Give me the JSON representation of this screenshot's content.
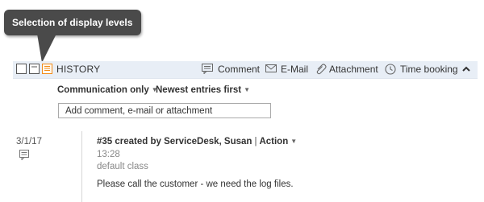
{
  "tooltip": {
    "text": "Selection of display levels"
  },
  "header": {
    "view_icons": [
      "view-compact-icon",
      "view-medium-icon",
      "view-detailed-icon"
    ],
    "selected_view_index": 2,
    "title": "HISTORY",
    "actions": [
      {
        "label": "Comment",
        "icon": "comment-icon"
      },
      {
        "label": "E-Mail",
        "icon": "email-icon"
      },
      {
        "label": "Attachment",
        "icon": "paperclip-icon"
      },
      {
        "label": "Time booking",
        "icon": "clock-icon"
      }
    ],
    "collapse_icon": "chevron-up-icon"
  },
  "filters": {
    "type": "Communication only",
    "sort": "Newest entries first"
  },
  "input": {
    "placeholder": "Add comment, e-mail or attachment"
  },
  "entry": {
    "date": "3/1/17",
    "icon": "comment-icon",
    "title": "#35 created by ServiceDesk, Susan",
    "separator": "|",
    "action_label": "Action",
    "time": "13:28",
    "class": "default class",
    "body": "Please call the customer - we need the log files."
  },
  "colors": {
    "accent": "#f28c1a",
    "header_bg": "#e8eef6",
    "tooltip_bg": "#4a4a4a"
  }
}
